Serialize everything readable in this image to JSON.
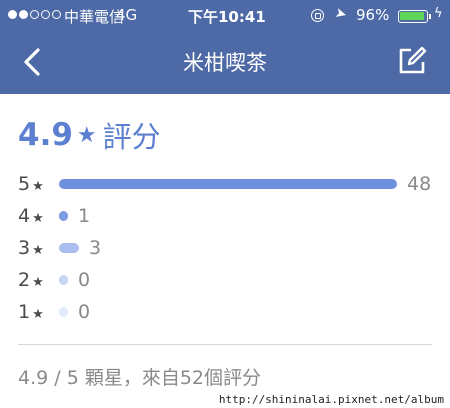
{
  "status_bar": {
    "signal_bars_filled": 2,
    "signal_bars_total": 5,
    "carrier": "中華電信",
    "network": "4G",
    "time": "下午10:41",
    "battery": "96%",
    "battery_level": 0.96,
    "battery_color": "#5fd55c"
  },
  "nav": {
    "title": "米柑喫茶",
    "back_icon": "chevron-left-icon",
    "edit_icon": "edit-icon"
  },
  "rating": {
    "score": "4.9",
    "label": "評分",
    "accent": "#5c7fcf"
  },
  "breakdown": [
    {
      "stars": "5",
      "count": "48",
      "fraction": 1.0,
      "color": "#6f8fdf"
    },
    {
      "stars": "4",
      "count": "1",
      "fraction": 0.02,
      "color": "#7d9be3"
    },
    {
      "stars": "3",
      "count": "3",
      "fraction": 0.06,
      "color": "#a9bdef"
    },
    {
      "stars": "2",
      "count": "0",
      "fraction": 0.0,
      "color": "#c7d5f5"
    },
    {
      "stars": "1",
      "count": "0",
      "fraction": 0.0,
      "color": "#e3eafb"
    }
  ],
  "summary": "4.9 / 5 顆星，來自52個評分",
  "watermark": "http://shininalai.pixnet.net/album",
  "colors": {
    "header": "#4d69a6"
  }
}
